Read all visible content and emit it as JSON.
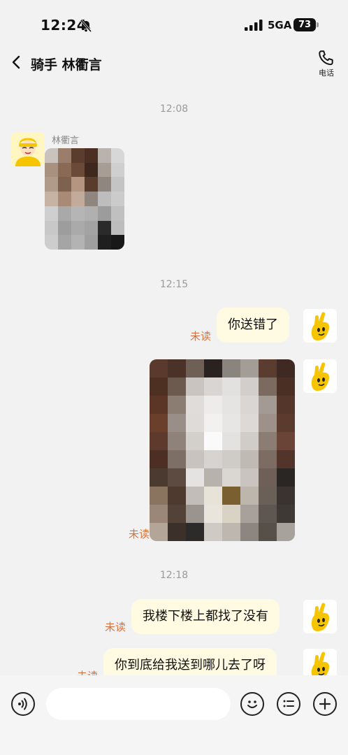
{
  "status_bar": {
    "time": "12:24",
    "network": "5GA",
    "battery": "73"
  },
  "header": {
    "back_icon": "chevron-left-icon",
    "title": "骑手 林衢言",
    "phone_icon": "phone-icon",
    "phone_label": "电话"
  },
  "messages": {
    "time_1": "12:08",
    "sender_name": "林衢言",
    "time_2": "12:15",
    "text_1": "你送错了",
    "unread_1": "未读",
    "unread_2": "未读",
    "time_3": "12:18",
    "text_2": "我楼下楼上都找了没有",
    "unread_3": "未读",
    "text_3": "你到底给我送到哪儿去了呀",
    "unread_4": "未读"
  },
  "input_bar": {
    "voice_icon": "voice-icon",
    "placeholder": "",
    "emoji_icon": "emoji-icon",
    "quick_reply_icon": "list-icon",
    "plus_icon": "plus-icon"
  },
  "colors": {
    "background": "#f2f2f2",
    "bubble": "#fffbe3",
    "unread": "#d9733a",
    "mascot": "#f7c400"
  }
}
